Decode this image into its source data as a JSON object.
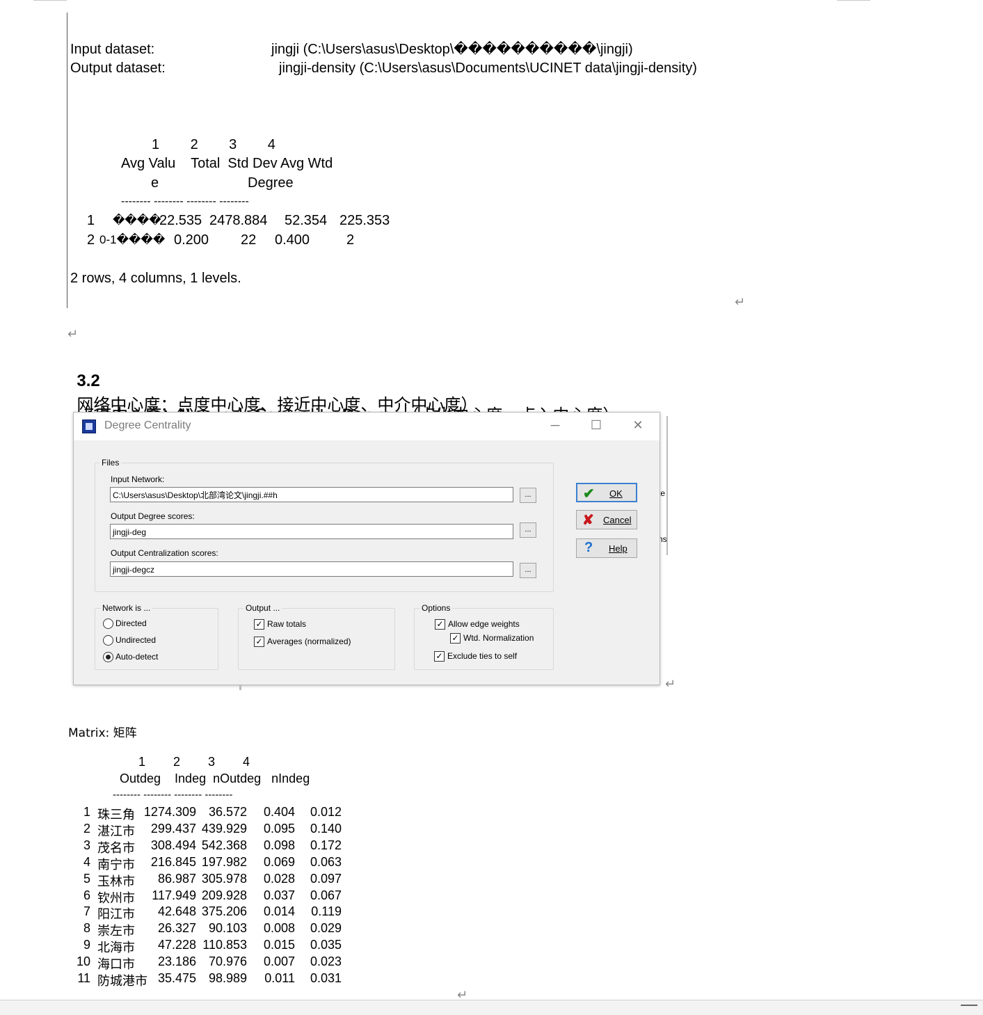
{
  "output1": {
    "input_label": "Input dataset:",
    "input_value": "jingji (C:\\Users\\asus\\Desktop\\����������\\jingji)",
    "output_label": "Output dataset:",
    "output_value": "jingji-density (C:\\Users\\asus\\Documents\\UCINET data\\jingji-density)",
    "col_numbers": "1        2        3        4",
    "header_line1": "Avg Valu    Total  Std Dev Avg Wtd",
    "header_line2_a": "e",
    "header_line2_b": "Degree",
    "separator": "-------- -------- -------- --------",
    "rows": [
      {
        "idx": "1",
        "name": "����",
        "c1": "22.535",
        "c2": "2478.884",
        "c3": "52.354",
        "c4": "225.353"
      },
      {
        "idx": "2",
        "name": "0-1����",
        "c1": "0.200",
        "c2": "22",
        "c3": "0.400",
        "c4": "2"
      }
    ],
    "summary": "2 rows, 4 columns, 1 levels."
  },
  "return_mark": "↵",
  "section": {
    "number": "3.2",
    "title": "网络中心度：点度中心度、接近中心度、中介中心度）",
    "subtitle": "点度中心度：Network-Centrality-Degree（点出中心度、点入中心度）"
  },
  "dialog": {
    "title": "Degree Centrality",
    "files_group": "Files",
    "input_network_label": "Input Network:",
    "input_network_value": "C:\\Users\\asus\\Desktop\\北部湾论文\\jingji.##h",
    "output_degree_label": "Output Degree scores:",
    "output_degree_value": "jingji-deg",
    "output_central_label": "Output Centralization scores:",
    "output_central_value": "jingji-degcz",
    "browse_label": "...",
    "ok_label": "OK",
    "cancel_label": "Cancel",
    "help_label": "Help",
    "network_group": "Network is ...",
    "network_options": [
      "Directed",
      "Undirected",
      "Auto-detect"
    ],
    "network_selected": "Auto-detect",
    "output_group": "Output ...",
    "output_options": [
      "Raw totals",
      "Averages (normalized)"
    ],
    "options_group": "Options",
    "options": [
      "Allow edge weights",
      "Wtd. Normalization",
      "Exclude ties to self"
    ],
    "peek_text_1": "te",
    "peek_text_2": "ns"
  },
  "output2": {
    "matrix_label": "Matrix: 矩阵",
    "col_numbers": "1        2        3        4",
    "headers": "Outdeg    Indeg  nOutdeg   nIndeg",
    "separator": "-------- -------- -------- --------",
    "rows": [
      {
        "idx": "1",
        "name": "珠三角",
        "c1": "1274.309",
        "c2": "36.572",
        "c3": "0.404",
        "c4": "0.012"
      },
      {
        "idx": "2",
        "name": "湛江市",
        "c1": "299.437",
        "c2": "439.929",
        "c3": "0.095",
        "c4": "0.140"
      },
      {
        "idx": "3",
        "name": "茂名市",
        "c1": "308.494",
        "c2": "542.368",
        "c3": "0.098",
        "c4": "0.172"
      },
      {
        "idx": "4",
        "name": "南宁市",
        "c1": "216.845",
        "c2": "197.982",
        "c3": "0.069",
        "c4": "0.063"
      },
      {
        "idx": "5",
        "name": "玉林市",
        "c1": "86.987",
        "c2": "305.978",
        "c3": "0.028",
        "c4": "0.097"
      },
      {
        "idx": "6",
        "name": "钦州市",
        "c1": "117.949",
        "c2": "209.928",
        "c3": "0.037",
        "c4": "0.067"
      },
      {
        "idx": "7",
        "name": "阳江市",
        "c1": "42.648",
        "c2": "375.206",
        "c3": "0.014",
        "c4": "0.119"
      },
      {
        "idx": "8",
        "name": "崇左市",
        "c1": "26.327",
        "c2": "90.103",
        "c3": "0.008",
        "c4": "0.029"
      },
      {
        "idx": "9",
        "name": "北海市",
        "c1": "47.228",
        "c2": "110.853",
        "c3": "0.015",
        "c4": "0.035"
      },
      {
        "idx": "10",
        "name": "海口市",
        "c1": "23.186",
        "c2": "70.976",
        "c3": "0.007",
        "c4": "0.023"
      },
      {
        "idx": "11",
        "name": "防城港市",
        "c1": "35.475",
        "c2": "98.989",
        "c3": "0.011",
        "c4": "0.031"
      }
    ]
  }
}
